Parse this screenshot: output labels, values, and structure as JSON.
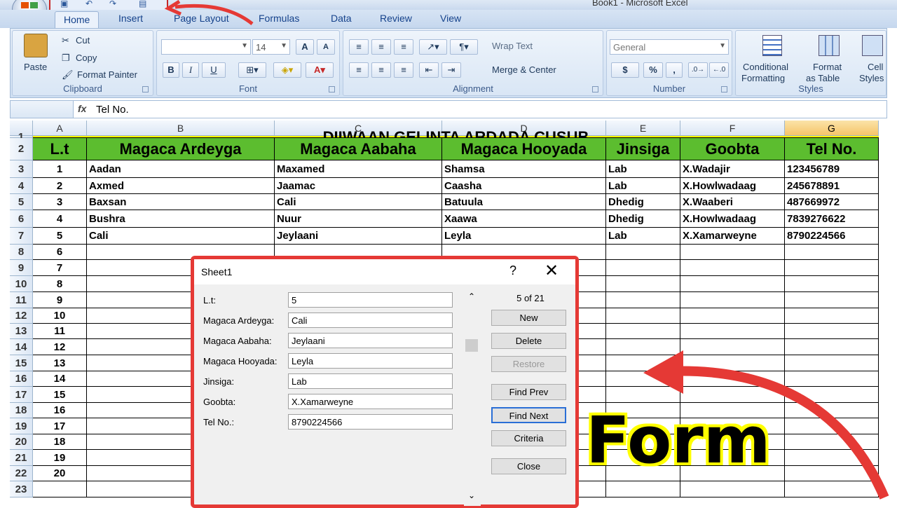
{
  "window": {
    "title": "Book1 - Microsoft Excel"
  },
  "ribbon_tabs": [
    "Home",
    "Insert",
    "Page Layout",
    "Formulas",
    "Data",
    "Review",
    "View"
  ],
  "clipboard": {
    "paste": "Paste",
    "cut": "Cut",
    "copy": "Copy",
    "format_painter": "Format Painter",
    "label": "Clipboard"
  },
  "font": {
    "size": "14",
    "bold": "B",
    "italic": "I",
    "underline": "U",
    "label": "Font"
  },
  "alignment": {
    "wrap_text": "Wrap Text",
    "merge_center": "Merge & Center",
    "label": "Alignment"
  },
  "number": {
    "format": "General",
    "currency": "$",
    "percent": "%",
    "comma": ",",
    "label": "Number"
  },
  "styles": {
    "conditional": "Conditional",
    "formatting": "Formatting",
    "format": "Format",
    "as_table": "as Table",
    "cell": "Cell",
    "cell_styles": "Styles",
    "label": "Styles"
  },
  "formula_bar": {
    "fx": "fx",
    "value": "Tel No."
  },
  "columns": [
    "A",
    "B",
    "C",
    "D",
    "E",
    "F",
    "G"
  ],
  "rows": [
    "1",
    "2",
    "3",
    "4",
    "5",
    "6",
    "7",
    "8",
    "9",
    "10",
    "11",
    "12",
    "13",
    "14",
    "15",
    "16",
    "17",
    "18",
    "19",
    "20",
    "21",
    "22",
    "23"
  ],
  "sheet_title": "DIIWAAN GELINTA ARDADA CUSUB",
  "headers": [
    "L.t",
    "Magaca Ardeyga",
    "Magaca Aabaha",
    "Magaca Hooyada",
    "Jinsiga",
    "Goobta",
    "Tel No."
  ],
  "data_rows": [
    [
      "1",
      "Aadan",
      "Maxamed",
      "Shamsa",
      "Lab",
      "X.Wadajir",
      "123456789"
    ],
    [
      "2",
      "Axmed",
      "Jaamac",
      "Caasha",
      "Lab",
      "X.Howlwadaag",
      "245678891"
    ],
    [
      "3",
      "Baxsan",
      "Cali",
      "Batuula",
      "Dhedig",
      "X.Waaberi",
      "487669972"
    ],
    [
      "4",
      "Bushra",
      "Nuur",
      "Xaawa",
      "Dhedig",
      "X.Howlwadaag",
      "7839276622"
    ],
    [
      "5",
      "Cali",
      "Jeylaani",
      "Leyla",
      "Lab",
      "X.Xamarweyne",
      "8790224566"
    ]
  ],
  "serials": [
    "6",
    "7",
    "8",
    "9",
    "10",
    "11",
    "12",
    "13",
    "14",
    "15",
    "16",
    "17",
    "18",
    "19",
    "20"
  ],
  "dialog": {
    "title": "Sheet1",
    "help": "?",
    "close_x": "✕",
    "counter": "5 of 21",
    "fields": [
      {
        "label": "L.t:",
        "value": "5"
      },
      {
        "label": "Magaca Ardeyga:",
        "value": "Cali"
      },
      {
        "label": "Magaca Aabaha:",
        "value": "Jeylaani"
      },
      {
        "label": "Magaca Hooyada:",
        "value": "Leyla"
      },
      {
        "label": "Jinsiga:",
        "value": "Lab"
      },
      {
        "label": "Goobta:",
        "value": "X.Xamarweyne"
      },
      {
        "label": "Tel No.:",
        "value": "8790224566"
      }
    ],
    "buttons": {
      "new": "New",
      "delete": "Delete",
      "restore": "Restore",
      "find_prev": "Find Prev",
      "find_next": "Find Next",
      "criteria": "Criteria",
      "close": "Close"
    }
  },
  "overlay": {
    "caption": "Form",
    "arrow_color": "#e53935",
    "caption_outline": "#ffff00"
  }
}
